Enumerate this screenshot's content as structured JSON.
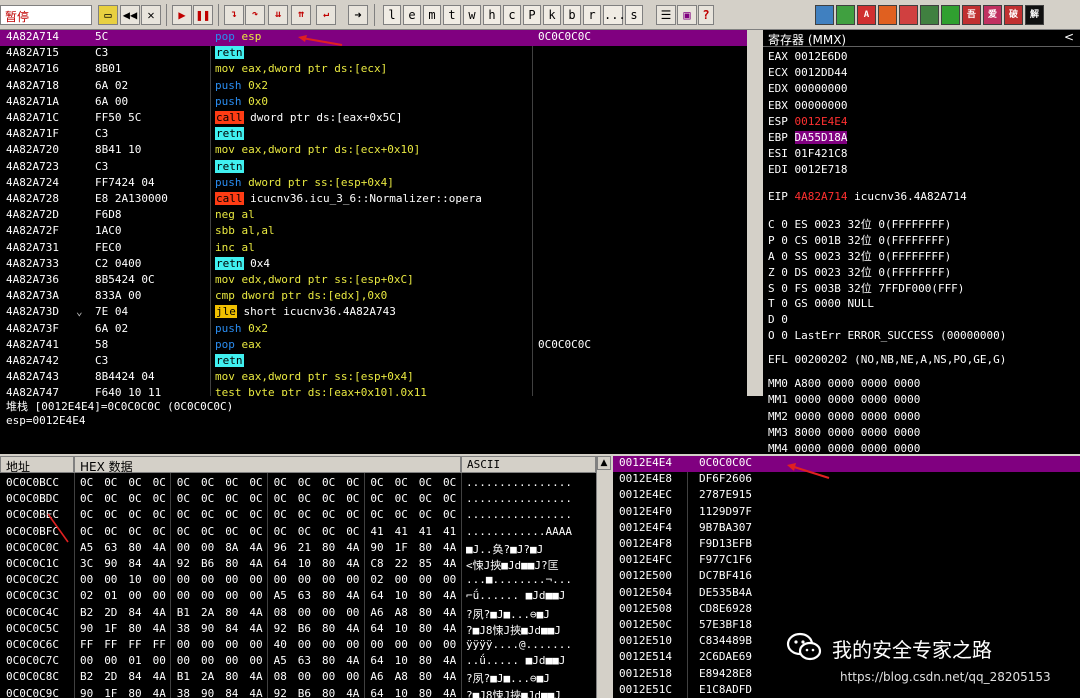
{
  "toolbar": {
    "status": "暂停",
    "letters": [
      "l",
      "e",
      "m",
      "t",
      "w",
      "h",
      "c",
      "P",
      "k",
      "b",
      "r",
      "...",
      "s"
    ],
    "colors": [
      "#4080c0",
      "#40a040",
      "#d03030",
      "#e06020",
      "#d04040",
      "#408040",
      "#30a030",
      "#c03030",
      "#c03060",
      "#c03030",
      "#101010"
    ],
    "color_labels": [
      "",
      "",
      "A",
      "",
      "",
      "",
      "",
      "吾",
      "爱",
      "破",
      "解",
      ""
    ]
  },
  "disasm": {
    "rows": [
      {
        "addr": "4A82A714",
        "hex": "5C",
        "mnem": "pop",
        "ops": "esp",
        "cmt": "0C0C0C0C",
        "selected": true
      },
      {
        "addr": "4A82A715",
        "hex": "C3",
        "mnem": "retn",
        "ops": ""
      },
      {
        "addr": "4A82A716",
        "hex": "8B01",
        "mnem": "mov",
        "ops": "eax,dword ptr ds:[ecx]"
      },
      {
        "addr": "4A82A718",
        "hex": "6A 02",
        "mnem": "push",
        "ops": "0x2"
      },
      {
        "addr": "4A82A71A",
        "hex": "6A 00",
        "mnem": "push",
        "ops": "0x0"
      },
      {
        "addr": "4A82A71C",
        "hex": "FF50 5C",
        "mnem": "call",
        "ops": "dword ptr ds:[eax+0x5C]"
      },
      {
        "addr": "4A82A71F",
        "hex": "C3",
        "mnem": "retn",
        "ops": ""
      },
      {
        "addr": "4A82A720",
        "hex": "8B41 10",
        "mnem": "mov",
        "ops": "eax,dword ptr ds:[ecx+0x10]"
      },
      {
        "addr": "4A82A723",
        "hex": "C3",
        "mnem": "retn",
        "ops": ""
      },
      {
        "addr": "4A82A724",
        "hex": "FF7424 04",
        "mnem": "push",
        "ops": "dword ptr ss:[esp+0x4]"
      },
      {
        "addr": "4A82A728",
        "hex": "E8 2A130000",
        "mnem": "call",
        "ops": "icucnv36.icu_3_6::Normalizer::opera"
      },
      {
        "addr": "4A82A72D",
        "hex": "F6D8",
        "mnem": "neg",
        "ops": "al"
      },
      {
        "addr": "4A82A72F",
        "hex": "1AC0",
        "mnem": "sbb",
        "ops": "al,al"
      },
      {
        "addr": "4A82A731",
        "hex": "FEC0",
        "mnem": "inc",
        "ops": "al"
      },
      {
        "addr": "4A82A733",
        "hex": "C2 0400",
        "mnem": "retn",
        "ops": "0x4"
      },
      {
        "addr": "4A82A736",
        "hex": "8B5424 0C",
        "mnem": "mov",
        "ops": "edx,dword ptr ss:[esp+0xC]"
      },
      {
        "addr": "4A82A73A",
        "hex": "833A 00",
        "mnem": "cmp",
        "ops": "dword ptr ds:[edx],0x0"
      },
      {
        "addr": "4A82A73D",
        "hex": "7E 04",
        "mnem": "jle",
        "ops": "short icucnv36.4A82A743",
        "mark": "⌄"
      },
      {
        "addr": "4A82A73F",
        "hex": "6A 02",
        "mnem": "push",
        "ops": "0x2"
      },
      {
        "addr": "4A82A741",
        "hex": "58",
        "mnem": "pop",
        "ops": "eax",
        "cmt": "0C0C0C0C"
      },
      {
        "addr": "4A82A742",
        "hex": "C3",
        "mnem": "retn",
        "ops": ""
      },
      {
        "addr": "4A82A743",
        "hex": "8B4424 04",
        "mnem": "mov",
        "ops": "eax,dword ptr ss:[esp+0x4]"
      },
      {
        "addr": "4A82A747",
        "hex": "F640 10 11",
        "mnem": "test",
        "ops": "byte ptr ds:[eax+0x10],0x11"
      }
    ]
  },
  "info": {
    "line1": "堆栈 [0012E4E4]=0C0C0C0C (0C0C0C0C)",
    "line2": "esp=0012E4E4"
  },
  "registers": {
    "title": "寄存器 (MMX)",
    "back": "<",
    "general": [
      {
        "name": "EAX",
        "value": "0012E6D0"
      },
      {
        "name": "ECX",
        "value": "0012DD44"
      },
      {
        "name": "EDX",
        "value": "00000000"
      },
      {
        "name": "EBX",
        "value": "00000000"
      },
      {
        "name": "ESP",
        "value": "0012E4E4",
        "changed": true
      },
      {
        "name": "EBP",
        "value": "DA55D18A",
        "highlight": true
      },
      {
        "name": "ESI",
        "value": "01F421C8"
      },
      {
        "name": "EDI",
        "value": "0012E718"
      }
    ],
    "eip": {
      "name": "EIP",
      "value": "4A82A714",
      "label": "icucnv36.4A82A714"
    },
    "flags": [
      "C 0   ES 0023 32位 0(FFFFFFFF)",
      "P 0   CS 001B 32位 0(FFFFFFFF)",
      "A 0   SS 0023 32位 0(FFFFFFFF)",
      "Z 0   DS 0023 32位 0(FFFFFFFF)",
      "S 0   FS 003B 32位 7FFDF000(FFF)",
      "T 0   GS 0000 NULL",
      "D 0",
      "O 0   LastErr ERROR_SUCCESS (00000000)"
    ],
    "efl": "EFL 00200202 (NO,NB,NE,A,NS,PO,GE,G)",
    "mmx": [
      "MM0 A800 0000 0000 0000",
      "MM1 0000 0000 0000 0000",
      "MM2 0000 0000 0000 0000",
      "MM3 8000 0000 0000 0000",
      "MM4 0000 0000 0000 0000"
    ]
  },
  "dump": {
    "headers": {
      "addr": "地址",
      "hex": "HEX 数据",
      "ascii": "ASCII"
    },
    "rows": [
      {
        "addr": "0C0C0BCC",
        "bytes": [
          "0C",
          "0C",
          "0C",
          "0C",
          "0C",
          "0C",
          "0C",
          "0C",
          "0C",
          "0C",
          "0C",
          "0C",
          "0C",
          "0C",
          "0C",
          "0C"
        ],
        "ascii": "................"
      },
      {
        "addr": "0C0C0BDC",
        "bytes": [
          "0C",
          "0C",
          "0C",
          "0C",
          "0C",
          "0C",
          "0C",
          "0C",
          "0C",
          "0C",
          "0C",
          "0C",
          "0C",
          "0C",
          "0C",
          "0C"
        ],
        "ascii": "................"
      },
      {
        "addr": "0C0C0BEC",
        "bytes": [
          "0C",
          "0C",
          "0C",
          "0C",
          "0C",
          "0C",
          "0C",
          "0C",
          "0C",
          "0C",
          "0C",
          "0C",
          "0C",
          "0C",
          "0C",
          "0C"
        ],
        "ascii": "................"
      },
      {
        "addr": "0C0C0BFC",
        "bytes": [
          "0C",
          "0C",
          "0C",
          "0C",
          "0C",
          "0C",
          "0C",
          "0C",
          "0C",
          "0C",
          "0C",
          "0C",
          "41",
          "41",
          "41",
          "41"
        ],
        "ascii": "............AAAA"
      },
      {
        "addr": "0C0C0C0C",
        "bytes": [
          "A5",
          "63",
          "80",
          "4A",
          "00",
          "00",
          "8A",
          "4A",
          "96",
          "21",
          "80",
          "4A",
          "90",
          "1F",
          "80",
          "4A"
        ],
        "ascii": "  ■J..奂?■J?■J"
      },
      {
        "addr": "0C0C0C1C",
        "bytes": [
          "3C",
          "90",
          "84",
          "4A",
          "92",
          "B6",
          "80",
          "4A",
          "64",
          "10",
          "80",
          "4A",
          "C8",
          "22",
          "85",
          "4A"
        ],
        "ascii": "<悚J挾■Jd■■J?匡"
      },
      {
        "addr": "0C0C0C2C",
        "bytes": [
          "00",
          "00",
          "10",
          "00",
          "00",
          "00",
          "00",
          "00",
          "00",
          "00",
          "00",
          "00",
          "02",
          "00",
          "00",
          "00"
        ],
        "ascii": "...■........¬..."
      },
      {
        "addr": "0C0C0C3C",
        "bytes": [
          "02",
          "01",
          "00",
          "00",
          "00",
          "00",
          "00",
          "00",
          "A5",
          "63",
          "80",
          "4A",
          "64",
          "10",
          "80",
          "4A"
        ],
        "ascii": "⌐ǘ......  ■Jd■■J"
      },
      {
        "addr": "0C0C0C4C",
        "bytes": [
          "B2",
          "2D",
          "84",
          "4A",
          "B1",
          "2A",
          "80",
          "4A",
          "08",
          "00",
          "00",
          "00",
          "A6",
          "A8",
          "80",
          "4A"
        ],
        "ascii": "?夙?■J■...⊖■J"
      },
      {
        "addr": "0C0C0C5C",
        "bytes": [
          "90",
          "1F",
          "80",
          "4A",
          "38",
          "90",
          "84",
          "4A",
          "92",
          "B6",
          "80",
          "4A",
          "64",
          "10",
          "80",
          "4A"
        ],
        "ascii": "?■J8悚J挾■Jd■■J"
      },
      {
        "addr": "0C0C0C6C",
        "bytes": [
          "FF",
          "FF",
          "FF",
          "FF",
          "00",
          "00",
          "00",
          "00",
          "40",
          "00",
          "00",
          "00",
          "00",
          "00",
          "00",
          "00"
        ],
        "ascii": "ÿÿÿÿ....@......."
      },
      {
        "addr": "0C0C0C7C",
        "bytes": [
          "00",
          "00",
          "01",
          "00",
          "00",
          "00",
          "00",
          "00",
          "A5",
          "63",
          "80",
          "4A",
          "64",
          "10",
          "80",
          "4A"
        ],
        "ascii": "..ǘ.....  ■Jd■■J"
      },
      {
        "addr": "0C0C0C8C",
        "bytes": [
          "B2",
          "2D",
          "84",
          "4A",
          "B1",
          "2A",
          "80",
          "4A",
          "08",
          "00",
          "00",
          "00",
          "A6",
          "A8",
          "80",
          "4A"
        ],
        "ascii": "?夙?■J■...⊖■J"
      },
      {
        "addr": "0C0C0C9C",
        "bytes": [
          "90",
          "1F",
          "80",
          "4A",
          "38",
          "90",
          "84",
          "4A",
          "92",
          "B6",
          "80",
          "4A",
          "64",
          "10",
          "80",
          "4A"
        ],
        "ascii": "?■J8悚J挾■Jd■■J"
      }
    ]
  },
  "stack": {
    "rows": [
      {
        "addr": "0012E4E4",
        "value": "0C0C0C0C",
        "top": true
      },
      {
        "addr": "0012E4E8",
        "value": "DF6F2606"
      },
      {
        "addr": "0012E4EC",
        "value": "2787E915"
      },
      {
        "addr": "0012E4F0",
        "value": "1129D97F"
      },
      {
        "addr": "0012E4F4",
        "value": "9B7BA307"
      },
      {
        "addr": "0012E4F8",
        "value": "F9D13EFB"
      },
      {
        "addr": "0012E4FC",
        "value": "F977C1F6"
      },
      {
        "addr": "0012E500",
        "value": "DC7BF416"
      },
      {
        "addr": "0012E504",
        "value": "DE535B4A"
      },
      {
        "addr": "0012E508",
        "value": "CD8E6928"
      },
      {
        "addr": "0012E50C",
        "value": "57E3BF18"
      },
      {
        "addr": "0012E510",
        "value": "C834489B"
      },
      {
        "addr": "0012E514",
        "value": "2C6DAE69"
      },
      {
        "addr": "0012E518",
        "value": "E89428E8"
      },
      {
        "addr": "0012E51C",
        "value": "E1C8ADFD"
      }
    ]
  },
  "watermark": {
    "name": "我的安全专家之路",
    "url": "https://blog.csdn.net/qq_28205153"
  },
  "accent": "#800080"
}
